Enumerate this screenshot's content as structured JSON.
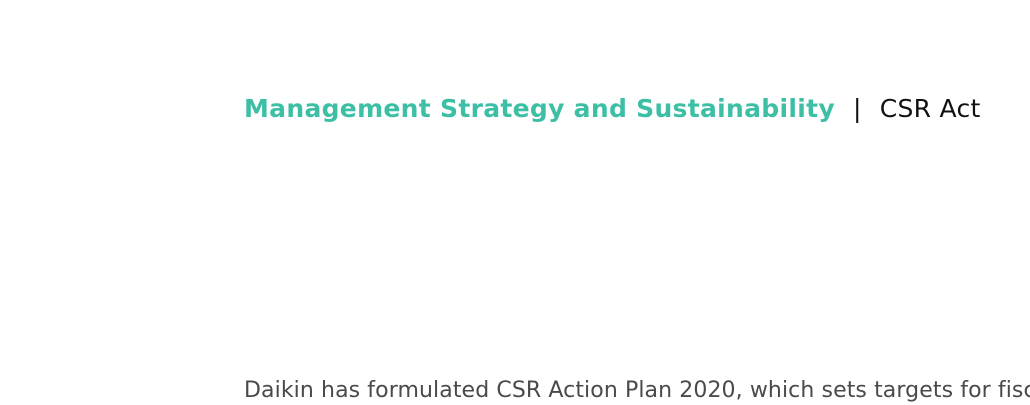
{
  "header": {
    "section": "Management Strategy and Sustainability",
    "separator": "|",
    "topic": "CSR Act"
  },
  "body": {
    "paragraph": "Daikin has formulated CSR Action Plan 2020, which sets targets for fisc"
  },
  "colors": {
    "accent": "#3dbfa6",
    "heading_text": "#111111",
    "body_text": "#4a4a4a"
  }
}
